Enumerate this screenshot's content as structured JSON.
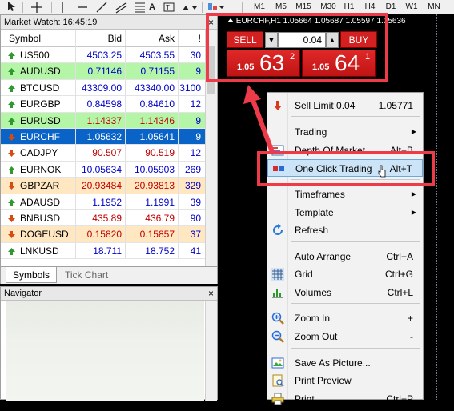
{
  "toolbar": {
    "timeframes": [
      "M1",
      "M5",
      "M15",
      "M30",
      "H1",
      "H4",
      "D1",
      "W1",
      "MN"
    ]
  },
  "market_watch": {
    "title": "Market Watch: 16:45:19",
    "close": "×",
    "headers": {
      "symbol": "Symbol",
      "bid": "Bid",
      "ask": "Ask",
      "spread": "!"
    },
    "rows": [
      {
        "symbol": "US500",
        "bid": "4503.25",
        "ask": "4503.55",
        "spread": "30",
        "dir": "up",
        "bg": "#ffffff"
      },
      {
        "symbol": "AUDUSD",
        "bid": "0.71146",
        "ask": "0.71155",
        "spread": "9",
        "dir": "up",
        "bg": "#b4f5a8"
      },
      {
        "symbol": "BTCUSD",
        "bid": "43309.00",
        "ask": "43340.00",
        "spread": "3100",
        "dir": "up",
        "bg": "#ffffff"
      },
      {
        "symbol": "EURGBP",
        "bid": "0.84598",
        "ask": "0.84610",
        "spread": "12",
        "dir": "up",
        "bg": "#ffffff"
      },
      {
        "symbol": "EURUSD",
        "bid": "1.14337",
        "ask": "1.14346",
        "spread": "9",
        "dir": "up",
        "bg": "#b4f5a8",
        "bid_red": true,
        "ask_red": true
      },
      {
        "symbol": "EURCHF",
        "bid": "1.05632",
        "ask": "1.05641",
        "spread": "9",
        "dir": "down",
        "bg": "#0a64c8",
        "selected": true
      },
      {
        "symbol": "CADJPY",
        "bid": "90.507",
        "ask": "90.519",
        "spread": "12",
        "dir": "down",
        "bg": "#ffffff",
        "bid_red": true,
        "ask_red": true
      },
      {
        "symbol": "EURNOK",
        "bid": "10.05634",
        "ask": "10.05903",
        "spread": "269",
        "dir": "up",
        "bg": "#ffffff"
      },
      {
        "symbol": "GBPZAR",
        "bid": "20.93484",
        "ask": "20.93813",
        "spread": "329",
        "dir": "down",
        "bg": "#ffe7c2",
        "bid_red": true,
        "ask_red": true
      },
      {
        "symbol": "ADAUSD",
        "bid": "1.1952",
        "ask": "1.1991",
        "spread": "39",
        "dir": "up",
        "bg": "#ffffff"
      },
      {
        "symbol": "BNBUSD",
        "bid": "435.89",
        "ask": "436.79",
        "spread": "90",
        "dir": "down",
        "bg": "#ffffff",
        "bid_red": true,
        "ask_red": true
      },
      {
        "symbol": "DOGEUSD",
        "bid": "0.15820",
        "ask": "0.15857",
        "spread": "37",
        "dir": "down",
        "bg": "#ffe7c2",
        "bid_red": true,
        "ask_red": true
      },
      {
        "symbol": "LNKUSD",
        "bid": "18.711",
        "ask": "18.752",
        "spread": "41",
        "dir": "up",
        "bg": "#ffffff"
      }
    ],
    "tabs": [
      "Symbols",
      "Tick Chart"
    ]
  },
  "navigator": {
    "title": "Navigator",
    "close": "×"
  },
  "chart": {
    "title": "EURCHF,H1  1.05664 1.05687 1.05597 1.05636",
    "sell_label": "SELL",
    "buy_label": "BUY",
    "lot": "0.04",
    "sell_price": {
      "prefix": "1.05",
      "big": "63",
      "sup": "2"
    },
    "buy_price": {
      "prefix": "1.05",
      "big": "64",
      "sup": "1"
    }
  },
  "context_menu": {
    "items": [
      {
        "label": "Sell Limit 0.04",
        "key": "1.05771",
        "icon": "sell-limit-icon"
      },
      {
        "label": "Trading",
        "submenu": true
      },
      {
        "label": "Depth Of Market",
        "key": "Alt+B",
        "icon": "depth-of-market-icon"
      },
      {
        "label": "One Click Trading",
        "key": "Alt+T",
        "icon": "one-click-trading-icon",
        "hover": true
      },
      {
        "label": "Timeframes",
        "submenu": true
      },
      {
        "label": "Template",
        "submenu": true
      },
      {
        "label": "Refresh",
        "icon": "refresh-icon"
      },
      {
        "label": "Auto Arrange",
        "key": "Ctrl+A"
      },
      {
        "label": "Grid",
        "key": "Ctrl+G",
        "icon": "grid-icon"
      },
      {
        "label": "Volumes",
        "key": "Ctrl+L",
        "icon": "volumes-icon"
      },
      {
        "label": "Zoom In",
        "key": "+",
        "icon": "zoom-in-icon"
      },
      {
        "label": "Zoom Out",
        "key": "-",
        "icon": "zoom-out-icon"
      },
      {
        "label": "Save As Picture...",
        "icon": "save-picture-icon"
      },
      {
        "label": "Print Preview",
        "icon": "print-preview-icon"
      },
      {
        "label": "Print",
        "key": "Ctrl+P",
        "icon": "print-icon"
      }
    ]
  },
  "colors": {
    "highlight": "#ee3b4a",
    "sell": "#d32020",
    "selected_row": "#0a64c8"
  }
}
